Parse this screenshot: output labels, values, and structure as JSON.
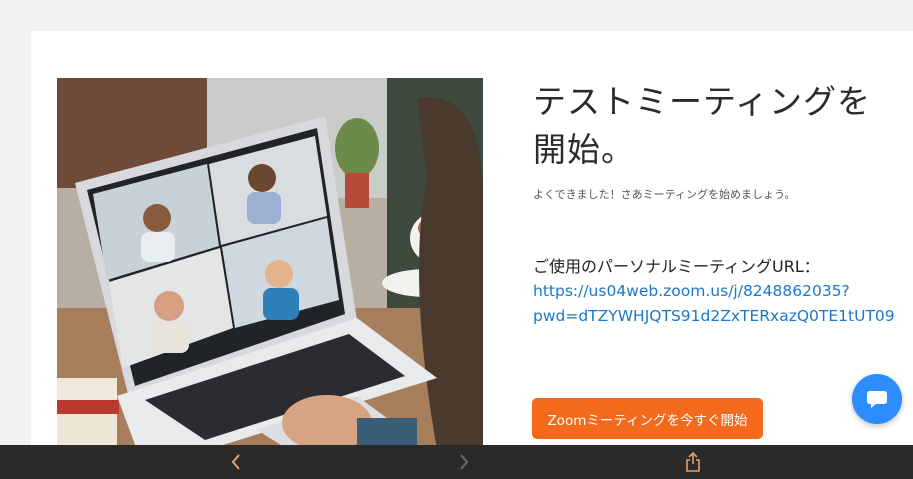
{
  "page": {
    "title": "テストミーティングを開始。",
    "subtitle": "よくできました！さあミーティングを始めましょう。",
    "url_label": "ご使用のパーソナルミーティングURL：",
    "url_line1": "https://us04web.zoom.us/j/8248862035?",
    "url_line2": "pwd=dTZYWHJQTS91d2ZxTERxazQ0TE1tUT09",
    "start_button_label": "Zoomミーティングを今すぐ開始"
  },
  "colors": {
    "accent_orange": "#f46a1c",
    "link_blue": "#1b78c9",
    "chat_blue": "#2d8cff",
    "toolbar_bg": "#2a2a2a",
    "toolbar_icon": "#e8a06a"
  },
  "icons": {
    "chat": "chat-bubble-icon",
    "back": "chevron-left-icon",
    "forward": "chevron-right-icon",
    "share": "share-icon"
  }
}
